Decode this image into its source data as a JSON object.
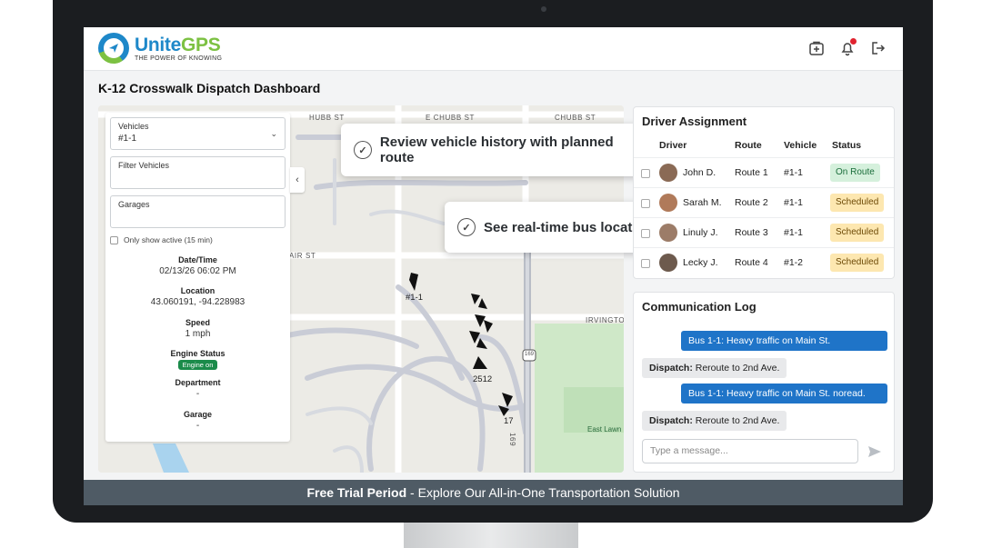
{
  "app": {
    "brand_name_part1": "Unite",
    "brand_name_part2": "GPS",
    "brand_tagline": "THE POWER OF KNOWING"
  },
  "page": {
    "title": "K-12 Crosswalk Dispatch Dashboard"
  },
  "map": {
    "streets": {
      "hubb_st": "HUBB ST",
      "e_chubb_st": "E CHUBB ST",
      "chubb_st": "CHUBB ST",
      "air_st": "AIR ST",
      "irvington": "IRVINGTON",
      "route_169_shield": "169",
      "route_169_vertical": "169",
      "east_lawn": "East Lawn"
    },
    "markers": [
      "#1-1",
      "2512",
      "17"
    ]
  },
  "vehicle_panel": {
    "vehicles_label": "Vehicles",
    "vehicles_value": "#1-1",
    "filter_label": "Filter Vehicles",
    "garages_label": "Garages",
    "only_active_label": "Only show active (15 min)",
    "datetime_label": "Date/Time",
    "datetime_value": "02/13/26 06:02 PM",
    "location_label": "Location",
    "location_value": "43.060191, -94.228983",
    "speed_label": "Speed",
    "speed_value": "1 mph",
    "engine_label": "Engine Status",
    "engine_value": "Engine on",
    "department_label": "Department",
    "department_value": "-",
    "garage_label": "Garage",
    "garage_value": "-"
  },
  "callouts": {
    "history": "Review vehicle history with planned route",
    "realtime": "See real-time bus location"
  },
  "driver_assignment": {
    "title": "Driver Assignment",
    "columns": [
      "Driver",
      "Route",
      "Vehicle",
      "Status"
    ],
    "rows": [
      {
        "driver": "John D.",
        "route": "Route 1",
        "vehicle": "#1-1",
        "status": "On Route"
      },
      {
        "driver": "Sarah M.",
        "route": "Route 2",
        "vehicle": "#1-1",
        "status": "Scheduled"
      },
      {
        "driver": "Linuly J.",
        "route": "Route 3",
        "vehicle": "#1-1",
        "status": "Scheduled"
      },
      {
        "driver": "Lecky J.",
        "route": "Route 4",
        "vehicle": "#1-2",
        "status": "Scheduled"
      }
    ],
    "colors": {
      "on_route_bg": "#d5f0dc",
      "scheduled_bg": "#fde7b0"
    }
  },
  "communication_log": {
    "title": "Communication Log",
    "messages": [
      {
        "direction": "outgoing",
        "text": "Bus 1-1: Heavy traffic on Main St."
      },
      {
        "direction": "incoming",
        "sender": "Dispatch:",
        "text": " Reroute to 2nd Ave."
      },
      {
        "direction": "outgoing",
        "text": "Bus 1-1: Heavy traffic on Main St. noread."
      },
      {
        "direction": "incoming",
        "sender": "Dispatch:",
        "text": " Reroute to 2nd Ave."
      }
    ],
    "input_placeholder": "Type a message...",
    "send_icon": "send-icon"
  },
  "footer": {
    "bold": "Free Trial Period",
    "rest": " - Explore Our All-in-One Transportation Solution"
  },
  "theme": {
    "brand_blue": "#1e88c9",
    "brand_green": "#7cc142",
    "outgoing_bubble": "#1f74c8",
    "footer_bg": "#4f5b65",
    "engine_on": "#1b8b4a"
  }
}
